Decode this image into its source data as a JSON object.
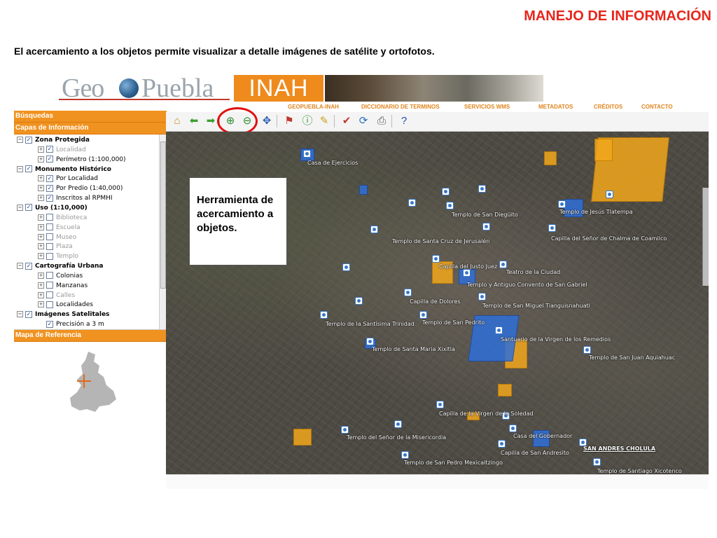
{
  "slide": {
    "title": "MANEJO DE INFORMACIÓN",
    "subtitle": "El acercamiento a los objetos permite visualizar a detalle imágenes de satélite y ortofotos."
  },
  "banner": {
    "geo": "Geo",
    "puebla": "Puebla",
    "inah": "INAH"
  },
  "topnav": [
    "GEOPUEBLA-INAH",
    "DICCIONARIO DE TERMINOS",
    "SERVICIOS WMS",
    "METADATOS",
    "CRÉDITOS",
    "CONTACTO"
  ],
  "sidebar": {
    "busquedas": "Búsquedas",
    "capas": "Capas de Información",
    "mapa_ref": "Mapa de Referencia",
    "tree": [
      {
        "label": "Zona Protegida",
        "level": 0,
        "checked": true,
        "bold": true,
        "dim": false
      },
      {
        "label": "Localidad",
        "level": 1,
        "checked": true,
        "bold": false,
        "dim": true
      },
      {
        "label": "Perímetro (1:100,000)",
        "level": 1,
        "checked": true,
        "bold": false,
        "dim": false
      },
      {
        "label": "Monumento Histórico",
        "level": 0,
        "checked": true,
        "bold": true,
        "dim": false
      },
      {
        "label": "Por Localidad",
        "level": 1,
        "checked": true,
        "bold": false,
        "dim": false
      },
      {
        "label": "Por Predio (1:40,000)",
        "level": 1,
        "checked": true,
        "bold": false,
        "dim": false
      },
      {
        "label": "Inscritos al RPMHI",
        "level": 1,
        "checked": true,
        "bold": false,
        "dim": false
      },
      {
        "label": "Uso (1:10,000)",
        "level": 0,
        "checked": true,
        "bold": true,
        "dim": false
      },
      {
        "label": "Biblioteca",
        "level": 1,
        "checked": false,
        "bold": false,
        "dim": true
      },
      {
        "label": "Escuela",
        "level": 1,
        "checked": false,
        "bold": false,
        "dim": true
      },
      {
        "label": "Museo",
        "level": 1,
        "checked": false,
        "bold": false,
        "dim": true
      },
      {
        "label": "Plaza",
        "level": 1,
        "checked": false,
        "bold": false,
        "dim": true
      },
      {
        "label": "Templo",
        "level": 1,
        "checked": false,
        "bold": false,
        "dim": true
      },
      {
        "label": "Cartografía Urbana",
        "level": 0,
        "checked": true,
        "bold": true,
        "dim": false
      },
      {
        "label": "Colonias",
        "level": 1,
        "checked": false,
        "bold": false,
        "dim": false
      },
      {
        "label": "Manzanas",
        "level": 1,
        "checked": false,
        "bold": false,
        "dim": false
      },
      {
        "label": "Calles",
        "level": 1,
        "checked": false,
        "bold": false,
        "dim": true
      },
      {
        "label": "Localidades",
        "level": 1,
        "checked": false,
        "bold": false,
        "dim": false
      },
      {
        "label": "Imágenes Satelitales",
        "level": 0,
        "checked": true,
        "bold": true,
        "dim": false
      },
      {
        "label": "Precisión a 3 m",
        "level": 2,
        "checked": true,
        "bold": false,
        "dim": false
      }
    ]
  },
  "toolbar": [
    {
      "name": "home-icon",
      "glyph": "⌂",
      "color": "#c98a12"
    },
    {
      "name": "back-arrow-icon",
      "glyph": "⬅",
      "color": "#3aa030"
    },
    {
      "name": "forward-arrow-icon",
      "glyph": "➡",
      "color": "#3aa030"
    },
    {
      "name": "zoom-in-icon",
      "glyph": "⊕",
      "color": "#2f8a2f"
    },
    {
      "name": "zoom-out-icon",
      "glyph": "⊖",
      "color": "#2f8a2f"
    },
    {
      "name": "pan-icon",
      "glyph": "✥",
      "color": "#2b5fb0"
    },
    {
      "name": "identify-pin-icon",
      "glyph": "⚑",
      "color": "#c0392b"
    },
    {
      "name": "info-icon",
      "glyph": "ⓘ",
      "color": "#2f8a2f"
    },
    {
      "name": "measure-ruler-icon",
      "glyph": "✎",
      "color": "#c9a018"
    },
    {
      "name": "marker-icon",
      "glyph": "✔",
      "color": "#c0392b"
    },
    {
      "name": "refresh-icon",
      "glyph": "⟳",
      "color": "#2b6fc0"
    },
    {
      "name": "print-icon",
      "glyph": "⎙",
      "color": "#555555"
    },
    {
      "name": "help-icon",
      "glyph": "?",
      "color": "#1f4fa8"
    }
  ],
  "callout": "Herramienta de acercamiento a objetos.",
  "map": {
    "labels": [
      "Casa de Ejercicios",
      "Templo de San Diegüito",
      "Templo de Jesús Tlatempa",
      "Capilla del Señor de Chalma de Coamilco",
      "Templo de Santa Cruz de Jerusalén",
      "Capilla del Justo Juez",
      "Teatro de la Ciudad",
      "Templo y Antiguo Convento de San Gabriel",
      "Capilla de Dolores",
      "Templo de San Miguel Tianguisnahuatl",
      "Templo de la Santísima Trinidad",
      "Templo de San Pedrito",
      "Santuario de la Virgen de los Remedios",
      "Templo de Santa María Xixitla",
      "Templo de San Juan Aquiahuac",
      "Capilla de la Virgen de la Soledad",
      "Templo del Señor de la Misericordia",
      "Casa del Gobernador",
      "SAN ANDRES CHOLULA",
      "Capilla de San Andresito",
      "Templo de San Pedro Mexicaltzingo",
      "Templo de Santiago Xicotenco"
    ]
  },
  "colors": {
    "accent": "#e8261c",
    "panel": "#f0921f",
    "protected_zone": "#f2a71c",
    "monument": "#2f6fd8"
  }
}
